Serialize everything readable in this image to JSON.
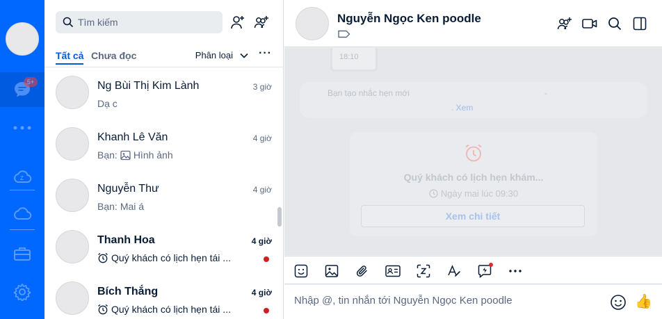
{
  "nav": {
    "badge": "5+",
    "icons": [
      "avatar",
      "chat-icon",
      "more-icon",
      "zcloud-icon",
      "cloud-icon",
      "briefcase-icon",
      "settings-icon"
    ]
  },
  "search": {
    "placeholder": "Tìm kiếm"
  },
  "list": {
    "tabs": [
      "Tất cả",
      "Chưa đọc"
    ],
    "filter_label": "Phân loại",
    "more": "···"
  },
  "conversations": [
    {
      "name": "Ng Bùi Thị Kim Lành",
      "time": "3 giờ",
      "preview": "Dạ c",
      "prefix": "",
      "icon": "",
      "unread": false
    },
    {
      "name": "Khanh Lê Văn",
      "time": "4 giờ",
      "preview": "Hình ảnh",
      "prefix": "Bạn:",
      "icon": "image-icon",
      "unread": false
    },
    {
      "name": "Nguyễn Thư",
      "time": "4 giờ",
      "preview": "Mai á",
      "prefix": "Bạn:",
      "icon": "",
      "unread": false
    },
    {
      "name": "Thanh Hoa",
      "time": "4 giờ",
      "preview": "Quý khách có lịch hẹn tái ...",
      "prefix": "",
      "icon": "alarm-icon",
      "unread": true
    },
    {
      "name": "Bích Thắng",
      "time": "4 giờ",
      "preview": "Quý khách có lịch hẹn tái ...",
      "prefix": "",
      "icon": "alarm-icon",
      "unread": true
    }
  ],
  "chat": {
    "title": "Nguyễn Ngọc Ken poodle",
    "old_message_time": "18:10",
    "reminder_note": "Bạn tạo nhắc hẹn mới",
    "reminder_dash": "-",
    "reminder_link": ". Xem",
    "card": {
      "title": "Quý khách có lịch hẹn khám...",
      "subtitle": "Ngày mai lúc 09:30",
      "button": "Xem chi tiết"
    },
    "composer_placeholder": "Nhập @, tin nhắn tới Nguyễn Ngọc Ken poodle",
    "like_emoji": "👍"
  },
  "colors": {
    "nav_bg": "#0068ff",
    "accent": "#005ae0",
    "unread_dot": "#d01e1e"
  }
}
